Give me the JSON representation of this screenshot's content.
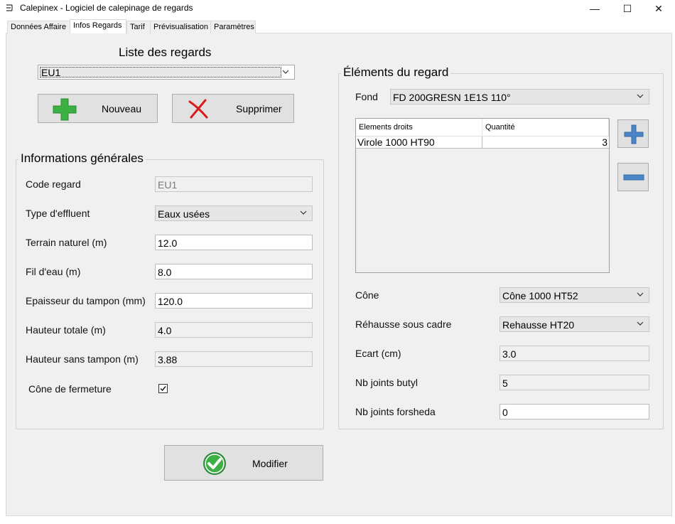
{
  "window": {
    "title": "Calepinex - Logiciel de calepinage de regards",
    "controls": {
      "minimize": "—",
      "maximize": "☐",
      "close": "✕"
    }
  },
  "tabs": [
    {
      "label": "Données Affaire",
      "active": false
    },
    {
      "label": "Infos Regards",
      "active": true
    },
    {
      "label": "Tarif",
      "active": false
    },
    {
      "label": "Prévisualisation",
      "active": false
    },
    {
      "label": "Paramètres",
      "active": false
    }
  ],
  "regards": {
    "heading": "Liste des regards",
    "selected": "EU1",
    "new_button": "Nouveau",
    "delete_button": "Supprimer"
  },
  "info": {
    "heading": "Informations générales",
    "code_label": "Code regard",
    "code_value": "EU1",
    "effluent_label": "Type d'effluent",
    "effluent_value": "Eaux usées",
    "terrain_label": "Terrain naturel (m)",
    "terrain_value": "12.0",
    "fil_label": "Fil d'eau (m)",
    "fil_value": "8.0",
    "epaisseur_label": "Epaisseur du tampon (mm)",
    "epaisseur_value": "120.0",
    "hauteur_totale_label": "Hauteur totale (m)",
    "hauteur_totale_value": "4.0",
    "hauteur_sans_label": "Hauteur sans tampon (m)",
    "hauteur_sans_value": "3.88",
    "cone_fermeture_label": "Cône de fermeture",
    "cone_fermeture_checked": true
  },
  "elements": {
    "heading": "Éléments du regard",
    "fond_label": "Fond",
    "fond_value": "FD 200GRESN 1E1S 110°",
    "table": {
      "columns": [
        "Elements droits",
        "Quantité"
      ],
      "rows": [
        {
          "element": "Virole 1000 HT90",
          "quantite": "3"
        }
      ]
    },
    "cone_label": "Cône",
    "cone_value": "Cône 1000 HT52",
    "rehausse_label": "Réhausse sous cadre",
    "rehausse_value": "Rehausse HT20",
    "ecart_label": "Ecart (cm)",
    "ecart_value": "3.0",
    "butyl_label": "Nb joints butyl",
    "butyl_value": "5",
    "forsheda_label": "Nb joints forsheda",
    "forsheda_value": "0"
  },
  "modify_button": "Modifier",
  "colors": {
    "green": "#3cb043",
    "red": "#d81c1c",
    "blue": "#4a86c8",
    "panel": "#f0f0f0"
  }
}
